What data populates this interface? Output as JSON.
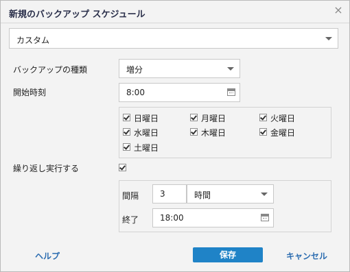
{
  "dialog": {
    "title": "新規のバックアップ スケジュール",
    "close_symbol": "×"
  },
  "schedule_type": {
    "value": "カスタム"
  },
  "backup_type": {
    "label": "バックアップの種類",
    "value": "増分"
  },
  "start_time": {
    "label": "開始時刻",
    "value": "8:00"
  },
  "days": [
    {
      "label": "日曜日",
      "checked": true
    },
    {
      "label": "月曜日",
      "checked": true
    },
    {
      "label": "火曜日",
      "checked": true
    },
    {
      "label": "水曜日",
      "checked": true
    },
    {
      "label": "木曜日",
      "checked": true
    },
    {
      "label": "金曜日",
      "checked": true
    },
    {
      "label": "土曜日",
      "checked": true
    }
  ],
  "repeat": {
    "label": "繰り返し実行する",
    "checked": true
  },
  "interval": {
    "label": "間隔",
    "value": "3",
    "unit": "時間"
  },
  "end": {
    "label": "終了",
    "value": "18:00"
  },
  "footer": {
    "help": "ヘルプ",
    "save": "保存",
    "cancel": "キャンセル"
  }
}
